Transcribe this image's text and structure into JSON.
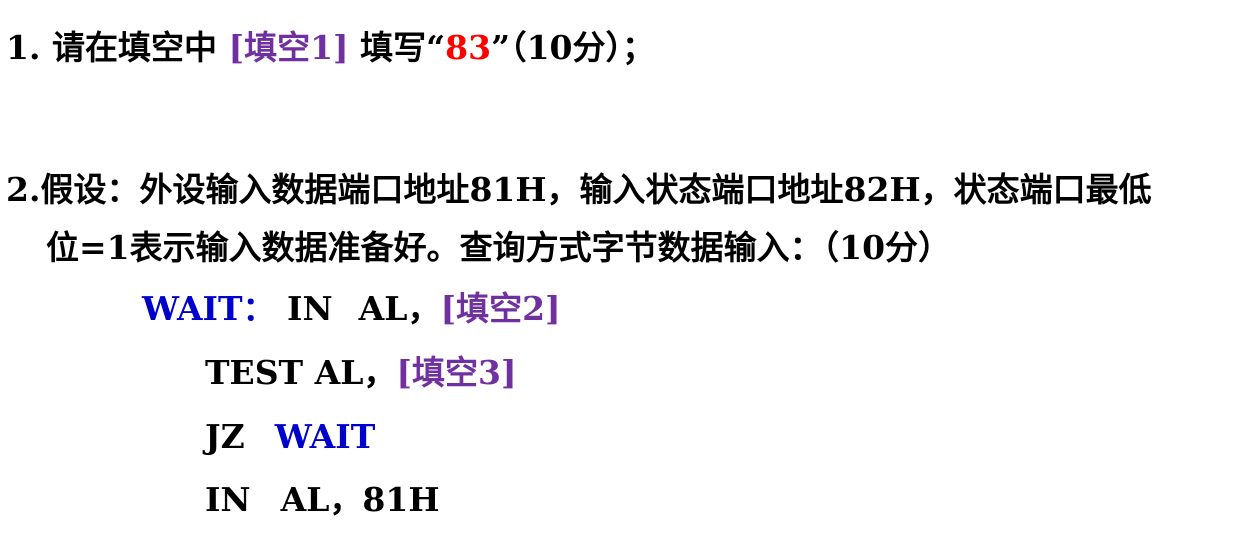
{
  "colors": {
    "text": "#000000",
    "blank_marker": "#7030A0",
    "answer": "#FF0000",
    "code_label": "#0000CC"
  },
  "q1": {
    "number": "1.",
    "text_a": "请在填空中",
    "blank": "[填空1]",
    "text_b": "填写",
    "open_quote": "“",
    "answer": "83",
    "close_quote": "”",
    "score": "（10分）；"
  },
  "q2": {
    "number": "2.",
    "line1": "假设：外设输入数据端口地址81H，输入状态端口地址82H，状态端口最低",
    "line2": "位=1表示输入数据准备好。查询方式字节数据输入：（10分）"
  },
  "code": {
    "line1": {
      "label": "WAIT：",
      "instr": "IN",
      "operand": "AL，",
      "blank": "[填空2]"
    },
    "line2": {
      "instr": "TEST",
      "operand": "AL，",
      "blank": "[填空3]"
    },
    "line3": {
      "instr": "JZ",
      "target": "WAIT"
    },
    "line4": {
      "instr": "IN",
      "operand": "AL，81H"
    }
  }
}
